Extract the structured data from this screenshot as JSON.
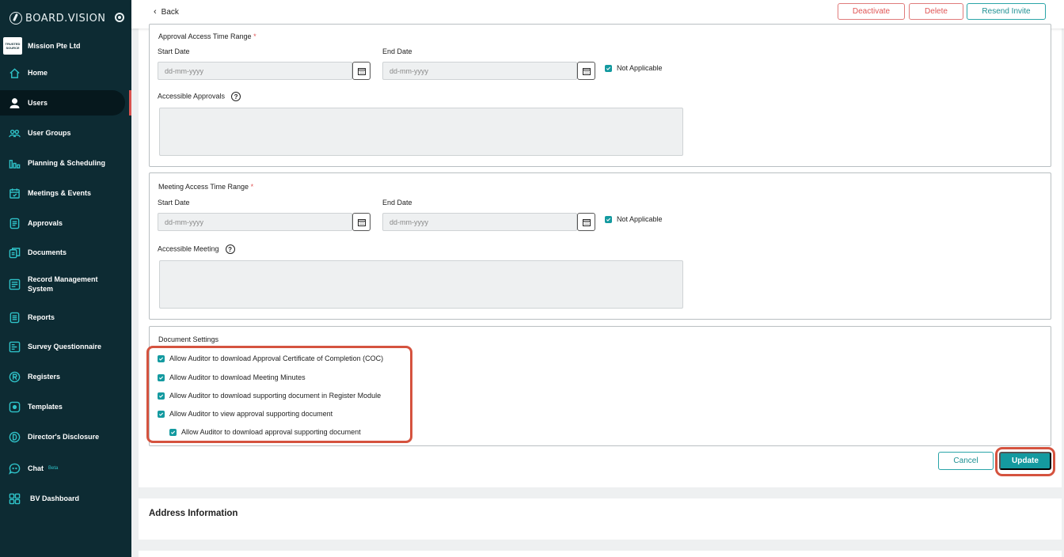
{
  "brand": {
    "name": "BOARD.VISION"
  },
  "org": {
    "logo_text": "TRUSTED SOURCE",
    "name": "Mission Pte Ltd"
  },
  "nav": [
    {
      "label": "Home",
      "icon": "home-icon"
    },
    {
      "label": "Users",
      "icon": "user-icon",
      "active": true
    },
    {
      "label": "User Groups",
      "icon": "user-groups-icon"
    },
    {
      "label": "Planning & Scheduling",
      "icon": "planning-icon"
    },
    {
      "label": "Meetings & Events",
      "icon": "calendar-icon"
    },
    {
      "label": "Approvals",
      "icon": "approvals-icon"
    },
    {
      "label": "Documents",
      "icon": "documents-icon"
    },
    {
      "label": "Record Management System",
      "icon": "record-icon"
    },
    {
      "label": "Reports",
      "icon": "reports-icon"
    },
    {
      "label": "Survey Questionnaire",
      "icon": "survey-icon"
    },
    {
      "label": "Registers",
      "icon": "registers-icon"
    },
    {
      "label": "Templates",
      "icon": "templates-icon"
    },
    {
      "label": "Director's Disclosure",
      "icon": "disclosure-icon"
    },
    {
      "label": "Chat",
      "badge": "Beta",
      "icon": "chat-icon"
    },
    {
      "label": "BV Dashboard",
      "icon": "dashboard-icon"
    }
  ],
  "topbar": {
    "back_label": "Back",
    "deactivate_label": "Deactivate",
    "delete_label": "Delete",
    "resend_label": "Resend Invite"
  },
  "approval_section": {
    "title": "Approval Access Time Range",
    "required_mark": "*",
    "start_label": "Start Date",
    "end_label": "End Date",
    "start_placeholder": "dd-mm-yyyy",
    "end_placeholder": "dd-mm-yyyy",
    "not_applicable_label": "Not Applicable",
    "accessible_label": "Accessible Approvals",
    "help_glyph": "?"
  },
  "meeting_section": {
    "title": "Meeting Access Time Range",
    "required_mark": "*",
    "start_label": "Start Date",
    "end_label": "End Date",
    "start_placeholder": "dd-mm-yyyy",
    "end_placeholder": "dd-mm-yyyy",
    "not_applicable_label": "Not Applicable",
    "accessible_label": "Accessible Meeting",
    "help_glyph": "?"
  },
  "document_settings": {
    "title": "Document Settings",
    "options": [
      {
        "label": "Allow Auditor to download Approval Certificate of Completion (COC)",
        "checked": true
      },
      {
        "label": "Allow Auditor to download Meeting Minutes",
        "checked": true
      },
      {
        "label": "Allow Auditor to download supporting document in Register Module",
        "checked": true
      },
      {
        "label": "Allow Auditor to view approval supporting document",
        "checked": true
      },
      {
        "label": "Allow Auditor to download approval supporting document",
        "checked": true
      }
    ]
  },
  "actions": {
    "cancel_label": "Cancel",
    "update_label": "Update"
  },
  "address": {
    "title": "Address Information"
  },
  "colors": {
    "sidebar": "#0d2b33",
    "accent": "#149aa0",
    "danger": "#e05555",
    "highlight": "#d5533f"
  }
}
